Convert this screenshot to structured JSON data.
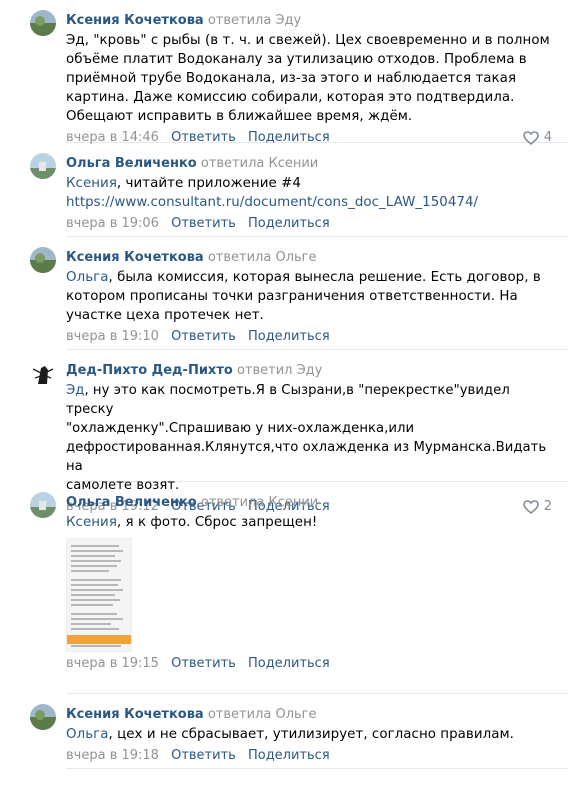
{
  "comments": [
    {
      "author": "Ксения Кочеткова",
      "replied_text": "ответила Эду",
      "mention": "",
      "lines": [
        "Эд, \"кровь\" с рыбы (в т. ч. и свежей). Цех своевременно и в полном",
        "объёме платит Водоканалу за утилизацию отходов. Проблема в",
        "приёмной трубе Водоканала, из-за этого и наблюдается такая",
        "картина. Даже комиссию собирали, которая это подтвердила.",
        "Обещают исправить в ближайшее время, ждём."
      ],
      "time": "вчера в 14:46",
      "reply": "Ответить",
      "share": "Поделиться",
      "likes": "4"
    },
    {
      "author": "Ольга Величенко",
      "replied_text": "ответила Ксении",
      "mention": "Ксения",
      "text_after_mention": ", читайте приложение #4",
      "link": "https://www.consultant.ru/document/cons_doc_LAW_150474/",
      "time": "вчера в 19:06",
      "reply": "Ответить",
      "share": "Поделиться"
    },
    {
      "author": "Ксения Кочеткова",
      "replied_text": "ответила Ольге",
      "mention": "Ольга",
      "line1_after_mention": ", была комиссия, которая вынесла решение. Есть договор, в",
      "lines": [
        "котором прописаны точки разграничения ответственности. На",
        "участке цеха протечек нет."
      ],
      "time": "вчера в 19:10",
      "reply": "Ответить",
      "share": "Поделиться"
    },
    {
      "author": "Дед-Пихто Дед-Пихто",
      "replied_text": "ответил Эду",
      "mention": "Эд",
      "line1_after_mention": ", ну это как посмотреть.Я в Сызрани,в \"перекрестке\"увидел треску",
      "lines": [
        "\"охлажденку\".Спрашиваю у них-охлажденка,или",
        "дефростированная.Клянутся,что охлажденка из Мурманска.Видать на",
        "самолете возят."
      ],
      "time": "вчера в 19:12",
      "reply": "Ответить",
      "share": "Поделиться",
      "likes": "2"
    },
    {
      "author": "Ольга Величенко",
      "replied_text": "ответила Ксении",
      "mention": "Ксения",
      "text_after_mention": ", я к фото. Сброс запрещен!",
      "time": "вчера в 19:15",
      "reply": "Ответить",
      "share": "Поделиться"
    },
    {
      "author": "Ксения Кочеткова",
      "replied_text": "ответила Ольге",
      "mention": "Ольга",
      "text_after_mention": ", цех и не сбрасывает, утилизирует, согласно правилам.",
      "time": "вчера в 19:18",
      "reply": "Ответить",
      "share": "Поделиться"
    }
  ],
  "icons": {
    "like": "heart-icon"
  },
  "colors": {
    "link": "#2a5885",
    "muted": "#939393",
    "divider": "#e7e8ec",
    "photo_bar": "#f3a23a"
  }
}
